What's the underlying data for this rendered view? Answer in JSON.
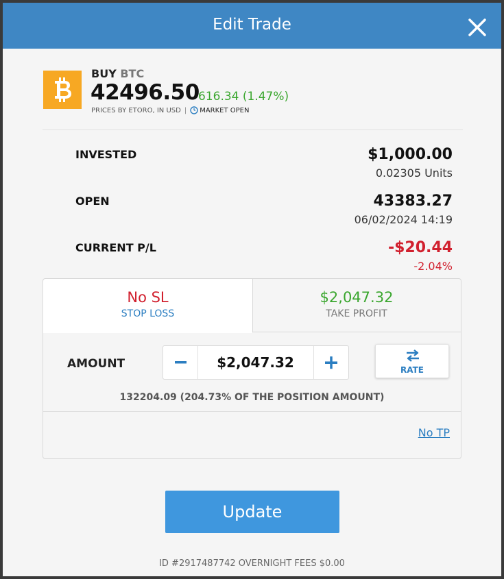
{
  "dialog": {
    "title": "Edit Trade",
    "header_color": "#3f87c4"
  },
  "asset": {
    "action": "BUY",
    "symbol": "BTC",
    "price": "42496.50",
    "change": "616.34 (1.47%)",
    "price_source": "PRICES BY ETORO, IN USD",
    "market_status": "MARKET OPEN",
    "logo_icon": "bitcoin-icon",
    "logo_color": "#f7a823"
  },
  "position": {
    "invested_label": "INVESTED",
    "invested_value": "$1,000.00",
    "invested_units": "0.02305 Units",
    "open_label": "OPEN",
    "open_value": "43383.27",
    "open_date": "06/02/2024 14:19",
    "pl_label": "CURRENT P/L",
    "pl_value": "-$20.44",
    "pl_percent": "-2.04%"
  },
  "tabs": {
    "stop_loss": {
      "value": "No SL",
      "label": "STOP LOSS"
    },
    "take_profit": {
      "value": "$2,047.32",
      "label": "TAKE PROFIT"
    }
  },
  "amount": {
    "label": "AMOUNT",
    "value": "$2,047.32",
    "rate_label": "RATE",
    "note": "132204.09 (204.73% OF THE POSITION AMOUNT)",
    "no_tp_label": "No TP"
  },
  "actions": {
    "update_label": "Update"
  },
  "footer": {
    "text": "ID #2917487742 OVERNIGHT FEES $0.00"
  },
  "colors": {
    "positive": "#3aa62e",
    "negative": "#d1202e",
    "link": "#2b7ec1",
    "button": "#3f97de"
  }
}
